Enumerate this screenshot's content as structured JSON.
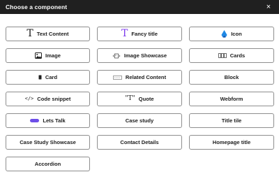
{
  "dialog": {
    "title": "Choose a component",
    "close_symbol": "×"
  },
  "components": [
    {
      "label": "Text Content",
      "icon": "serif-t-icon"
    },
    {
      "label": "Fancy title",
      "icon": "serif-t-purple-icon"
    },
    {
      "label": "Icon",
      "icon": "blue-logo-icon"
    },
    {
      "label": "Image",
      "icon": "image-icon"
    },
    {
      "label": "Image Showcase",
      "icon": "image-showcase-icon"
    },
    {
      "label": "Cards",
      "icon": "cards-icon"
    },
    {
      "label": "Card",
      "icon": "card-icon"
    },
    {
      "label": "Related Content",
      "icon": "related-content-icon"
    },
    {
      "label": "Block",
      "icon": ""
    },
    {
      "label": "Code snippet",
      "icon": "code-icon"
    },
    {
      "label": "Quote",
      "icon": "quote-icon"
    },
    {
      "label": "Webform",
      "icon": ""
    },
    {
      "label": "Lets Talk",
      "icon": "purple-pill-icon"
    },
    {
      "label": "Case study",
      "icon": ""
    },
    {
      "label": "Title tile",
      "icon": ""
    },
    {
      "label": "Case Study Showcase",
      "icon": ""
    },
    {
      "label": "Contact Details",
      "icon": ""
    },
    {
      "label": "Homepage title",
      "icon": ""
    },
    {
      "label": "Accordion",
      "icon": ""
    }
  ],
  "icon_glyphs": {
    "serif-t": "T",
    "code": "</>",
    "quote": "\"T\""
  },
  "colors": {
    "titlebar_bg": "#202020",
    "fancy_title_purple": "#7c3aed",
    "icon_blue": "#1e88e5",
    "pill_purple": "#6d4ee8"
  }
}
